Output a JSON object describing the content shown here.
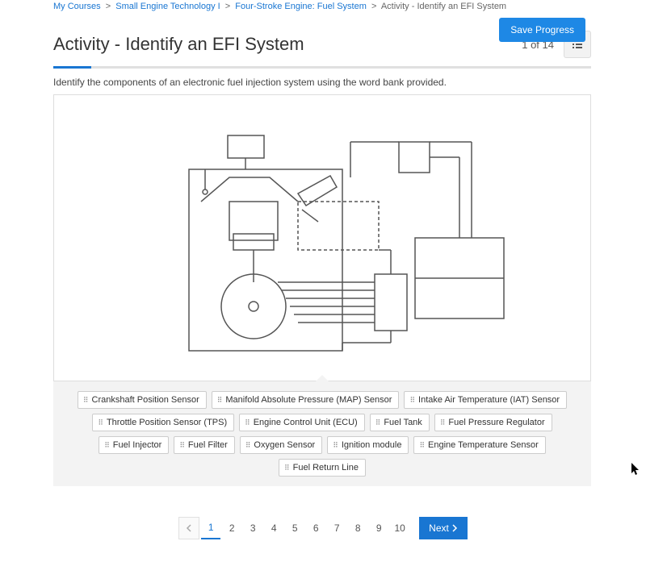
{
  "breadcrumb": {
    "items": [
      {
        "label": "My Courses"
      },
      {
        "label": "Small Engine Technology I"
      },
      {
        "label": "Four-Stroke Engine: Fuel System"
      }
    ],
    "current": "Activity - Identify an EFI System"
  },
  "save_button": "Save Progress",
  "page_title": "Activity - Identify an EFI System",
  "counter": "1 of 14",
  "instruction": "Identify the components of an electronic fuel injection system using the word bank provided.",
  "word_bank": [
    "Crankshaft Position Sensor",
    "Manifold Absolute Pressure (MAP) Sensor",
    "Intake Air Temperature (IAT) Sensor",
    "Throttle Position Sensor (TPS)",
    "Engine Control Unit (ECU)",
    "Fuel Tank",
    "Fuel Pressure Regulator",
    "Fuel Injector",
    "Fuel Filter",
    "Oxygen Sensor",
    "Ignition module",
    "Engine Temperature Sensor",
    "Fuel Return Line"
  ],
  "pager": {
    "pages": [
      "1",
      "2",
      "3",
      "4",
      "5",
      "6",
      "7",
      "8",
      "9",
      "10"
    ],
    "active": 0,
    "next": "Next"
  },
  "colors": {
    "accent": "#1976d2"
  }
}
